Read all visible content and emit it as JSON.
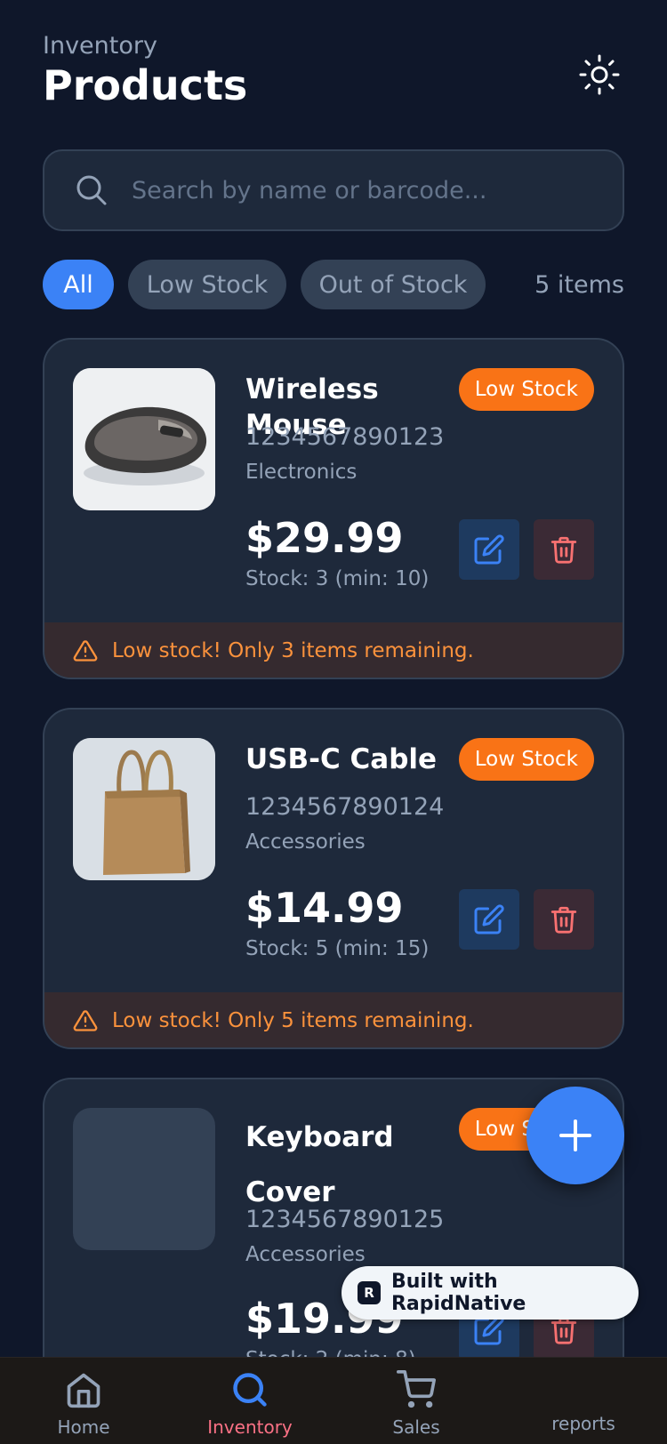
{
  "header": {
    "subtitle": "Inventory",
    "title": "Products"
  },
  "search": {
    "placeholder": "Search by name or barcode..."
  },
  "filters": {
    "chips": [
      "All",
      "Low Stock",
      "Out of Stock"
    ],
    "active": "All",
    "count_label": "5 items"
  },
  "products": [
    {
      "name": "Wireless Mouse",
      "badge": "Low Stock",
      "barcode": "1234567890123",
      "category": "Electronics",
      "price": "$29.99",
      "stock": "Stock: 3 (min: 10)",
      "warning": "Low stock! Only 3 items remaining."
    },
    {
      "name": "USB-C Cable",
      "badge": "Low Stock",
      "barcode": "1234567890124",
      "category": "Accessories",
      "price": "$14.99",
      "stock": "Stock: 5 (min: 15)",
      "warning": "Low stock! Only 5 items remaining."
    },
    {
      "name": "Keyboard Cover",
      "badge": "Low Stock",
      "barcode": "1234567890125",
      "category": "Accessories",
      "price": "$19.99",
      "stock": "Stock: 2 (min: 8)"
    }
  ],
  "built_with": "Built with RapidNative",
  "tabs": [
    {
      "label": "Home",
      "icon": "home-icon"
    },
    {
      "label": "Inventory",
      "icon": "search-icon",
      "active": true
    },
    {
      "label": "Sales",
      "icon": "cart-icon"
    },
    {
      "label": "reports",
      "icon": "chart-icon"
    }
  ],
  "colors": {
    "background": "#0f172a",
    "card": "#1e293b",
    "accent": "#3b82f6",
    "badge": "#f97316",
    "warning_text": "#fb923c",
    "active_tab": "#fb7185"
  }
}
